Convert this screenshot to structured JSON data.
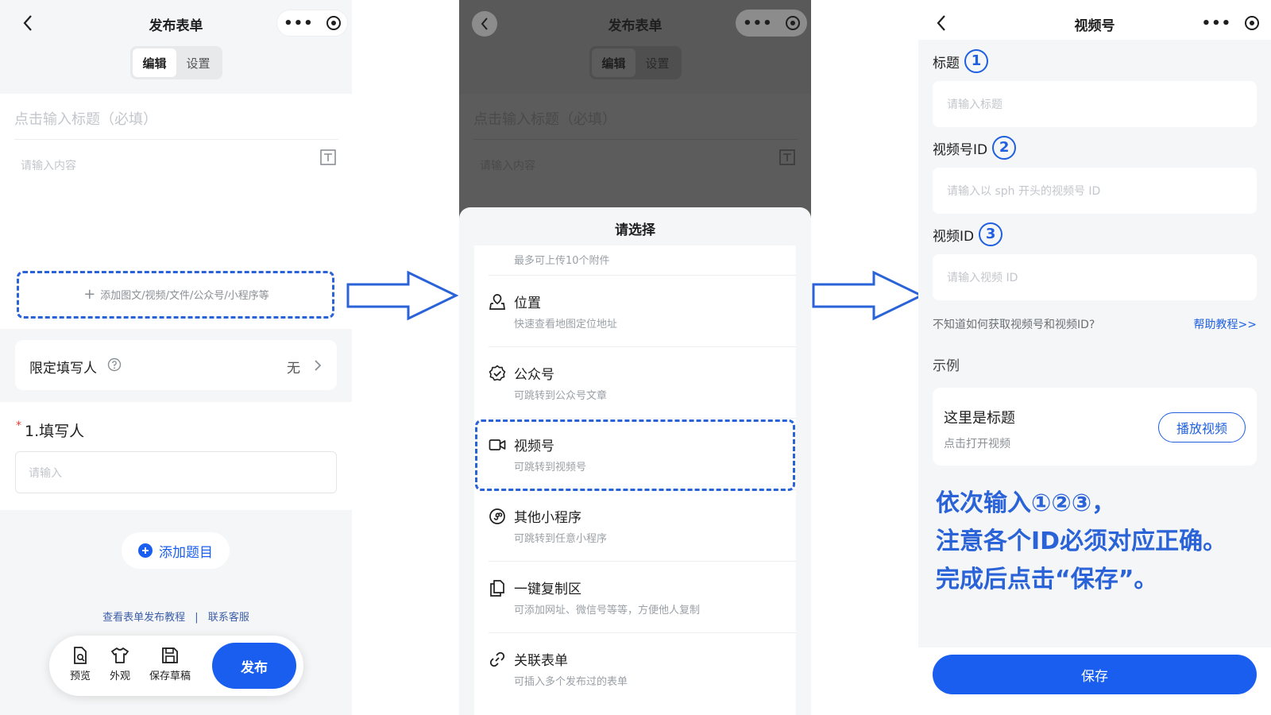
{
  "panel1": {
    "nav_title": "发布表单",
    "tabs": [
      {
        "label": "编辑"
      },
      {
        "label": "设置"
      }
    ],
    "title_placeholder": "点击输入标题（必填）",
    "content_placeholder": "请输入内容",
    "add_attachment": "添加图文/视频/文件/公众号/小程序等",
    "restrict_label": "限定填写人",
    "restrict_value": "无",
    "question_title": "1.填写人",
    "required_mark": "*",
    "question_placeholder": "请输入",
    "add_question": "添加题目",
    "link_tutorial": "查看表单发布教程",
    "link_divider": "|",
    "link_service": "联系客服",
    "toolbar": {
      "preview": "预览",
      "appearance": "外观",
      "save_draft": "保存草稿",
      "publish": "发布"
    }
  },
  "panel2": {
    "nav_title": "发布表单",
    "tabs": [
      {
        "label": "编辑"
      },
      {
        "label": "设置"
      }
    ],
    "title_placeholder": "点击输入标题（必填）",
    "content_placeholder": "请输入内容",
    "sheet_title": "请选择",
    "top_hint": "最多可上传10个附件",
    "options": [
      {
        "title": "位置",
        "desc": "快速查看地图定位地址",
        "icon": "location-icon"
      },
      {
        "title": "公众号",
        "desc": "可跳转到公众号文章",
        "icon": "badge-check-icon"
      },
      {
        "title": "视频号",
        "desc": "可跳转到视频号",
        "icon": "video-camera-icon"
      },
      {
        "title": "其他小程序",
        "desc": "可跳转到任意小程序",
        "icon": "mini-program-icon"
      },
      {
        "title": "一键复制区",
        "desc": "可添加网址、微信号等等，方便他人复制",
        "icon": "copy-icon"
      },
      {
        "title": "关联表单",
        "desc": "可插入多个发布过的表单",
        "icon": "link-icon"
      }
    ]
  },
  "panel3": {
    "nav_title": "视频号",
    "fields": [
      {
        "label": "标题",
        "num": "1",
        "placeholder": "请输入标题"
      },
      {
        "label": "视频号ID",
        "num": "2",
        "placeholder": "请输入以 sph 开头的视频号 ID"
      },
      {
        "label": "视频ID",
        "num": "3",
        "placeholder": "请输入视频 ID"
      }
    ],
    "help_question": "不知道如何获取视频号和视频ID?",
    "help_link": "帮助教程>>",
    "example_label": "示例",
    "example_title": "这里是标题",
    "example_sub": "点击打开视频",
    "play_button": "播放视频",
    "note_lines": [
      "依次输入①②③，",
      "注意各个ID必须对应正确。",
      "完成后点击“保存”。"
    ],
    "save_button": "保存"
  },
  "colors": {
    "accent": "#1a5ef0",
    "annotation": "#2a62d8",
    "overlay": "#595959"
  }
}
